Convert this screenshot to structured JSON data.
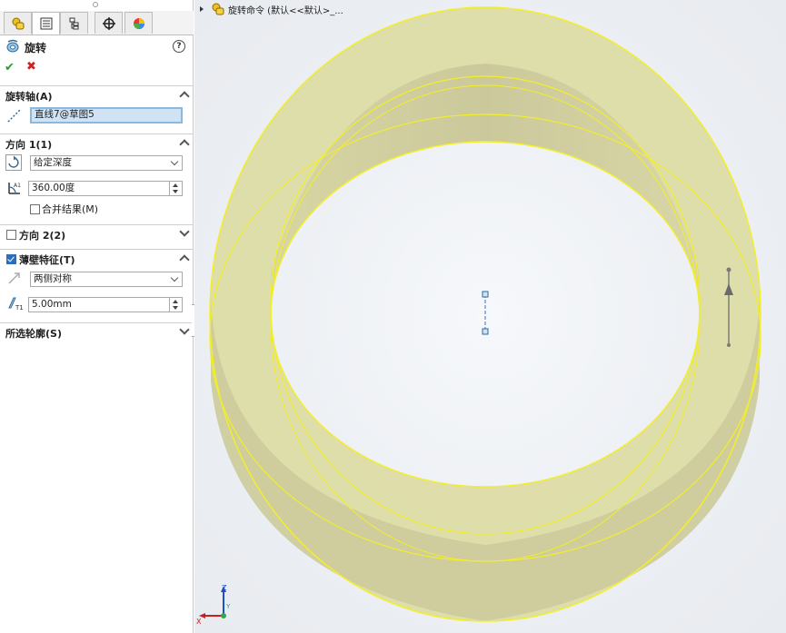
{
  "panel": {
    "tabs": [
      {
        "name": "tab-feature-manager",
        "icon": "feature-manager-icon"
      },
      {
        "name": "tab-property-manager",
        "icon": "property-manager-icon",
        "active": true
      },
      {
        "name": "tab-configuration-manager",
        "icon": "configuration-manager-icon"
      },
      {
        "name": "tab-dimxpert-manager",
        "icon": "dimxpert-icon"
      },
      {
        "name": "tab-display-manager",
        "icon": "display-manager-icon"
      }
    ],
    "feature_title": "旋转",
    "help_label": "?",
    "ok_symbol": "✔",
    "cancel_symbol": "✖",
    "axis_section": {
      "label": "旋转轴(A)",
      "value": "直线7@草图5"
    },
    "direction1": {
      "label": "方向 1(1)",
      "end_condition": "给定深度",
      "angle": "360.00度",
      "merge_label": "合并结果(M)",
      "merge_checked": false
    },
    "direction2": {
      "label": "方向 2(2)",
      "checked": false
    },
    "thin_feature": {
      "label": "薄壁特征(T)",
      "checked": true,
      "type": "两侧对称",
      "thickness": "5.00mm"
    },
    "selected_contours": {
      "label": "所选轮廓(S)"
    }
  },
  "viewport": {
    "tree_text": "旋转命令  (默认<<默认>_...",
    "colors": {
      "part_fill": "#dddca6",
      "part_edge": "#f2ee2a",
      "background": "#eceff3"
    },
    "triad": {
      "x": "X",
      "y": "Y",
      "z": "Z"
    }
  }
}
